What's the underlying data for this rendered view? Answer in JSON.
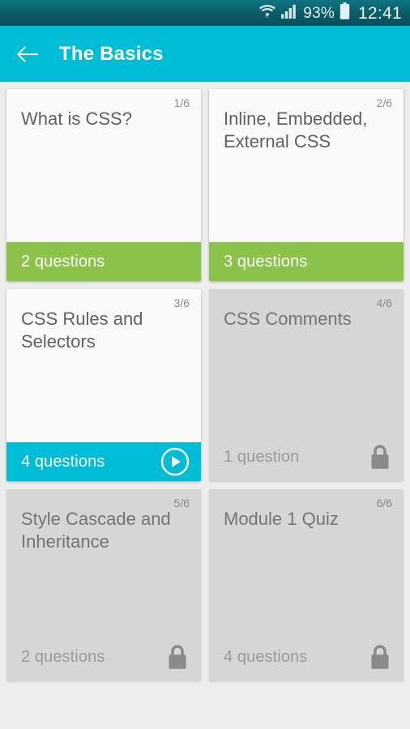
{
  "statusbar": {
    "wifi_icon": "wifi-icon",
    "signal_icon": "cellular-signal-icon",
    "battery_percent": "93%",
    "battery_icon": "battery-icon",
    "clock": "12:41"
  },
  "header": {
    "back_icon": "back-arrow-icon",
    "title": "The Basics"
  },
  "colors": {
    "accent_cyan": "#00bcd4",
    "progress_green": "#8bc34a",
    "locked_gray": "#d6d6d6",
    "page_background": "#ededed",
    "statusbar_teal": "#0a5b66"
  },
  "lessons": [
    {
      "counter": "1/6",
      "title": "What is CSS?",
      "questions": "2 questions",
      "state": "completed",
      "footer_style": "green",
      "icon": null
    },
    {
      "counter": "2/6",
      "title": "Inline, Embedded, External CSS",
      "questions": "3 questions",
      "state": "completed",
      "footer_style": "green",
      "icon": null
    },
    {
      "counter": "3/6",
      "title": "CSS Rules and Selectors",
      "questions": "4 questions",
      "state": "current",
      "footer_style": "cyan",
      "icon": "play-circle-icon"
    },
    {
      "counter": "4/6",
      "title": "CSS Comments",
      "questions": "1 question",
      "state": "locked",
      "footer_style": "plain",
      "icon": "lock-icon"
    },
    {
      "counter": "5/6",
      "title": "Style Cascade and Inheritance",
      "questions": "2 questions",
      "state": "locked",
      "footer_style": "plain",
      "icon": "lock-icon"
    },
    {
      "counter": "6/6",
      "title": "Module 1 Quiz",
      "questions": "4 questions",
      "state": "locked",
      "footer_style": "plain",
      "icon": "lock-icon"
    }
  ]
}
